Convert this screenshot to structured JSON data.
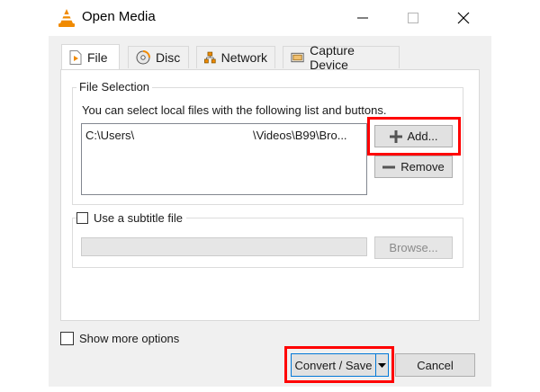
{
  "window": {
    "title": "Open Media"
  },
  "tabs": [
    {
      "label": "File",
      "icon": "file-play-icon",
      "active": true
    },
    {
      "label": "Disc",
      "icon": "disc-icon",
      "active": false
    },
    {
      "label": "Network",
      "icon": "network-icon",
      "active": false
    },
    {
      "label": "Capture Device",
      "icon": "capture-device-icon",
      "active": false
    }
  ],
  "file_selection": {
    "group_label": "File Selection",
    "description": "You can select local files with the following list and buttons.",
    "file_path_start": "C:\\Users\\",
    "file_path_end": "\\Videos\\B99\\Bro...",
    "add_label": "Add...",
    "remove_label": "Remove"
  },
  "subtitle": {
    "checkbox_label": "Use a subtitle file",
    "checked": false,
    "path_value": "",
    "browse_label": "Browse..."
  },
  "options": {
    "show_more_label": "Show more options",
    "checked": false
  },
  "footer": {
    "convert_save_label": "Convert / Save",
    "cancel_label": "Cancel"
  },
  "colors": {
    "highlight": "#ff0000",
    "vlc_orange": "#f08a00"
  }
}
